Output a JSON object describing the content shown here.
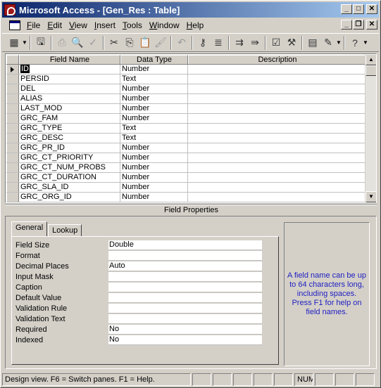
{
  "window": {
    "title": "Microsoft Access - [Gen_Res : Table]",
    "minimize": "_",
    "maximize": "□",
    "close": "✕"
  },
  "menu": {
    "items": [
      "File",
      "Edit",
      "View",
      "Insert",
      "Tools",
      "Window",
      "Help"
    ],
    "doc_min": "_",
    "doc_restore": "❐",
    "doc_close": "✕"
  },
  "toolbar": {
    "icons": [
      "view-icon",
      "save-icon",
      "print-icon",
      "print-preview-icon",
      "spelling-icon",
      "cut-icon",
      "copy-icon",
      "paste-icon",
      "format-painter-icon",
      "undo-icon",
      "primary-key-icon",
      "indexes-icon",
      "insert-rows-icon",
      "delete-rows-icon",
      "properties-icon",
      "build-icon",
      "database-window-icon",
      "new-object-icon",
      "help-icon"
    ]
  },
  "grid": {
    "headers": {
      "field_name": "Field Name",
      "data_type": "Data Type",
      "description": "Description"
    },
    "rows": [
      {
        "name": "ID",
        "type": "Number",
        "desc": ""
      },
      {
        "name": "PERSID",
        "type": "Text",
        "desc": ""
      },
      {
        "name": "DEL",
        "type": "Number",
        "desc": ""
      },
      {
        "name": "ALIAS",
        "type": "Number",
        "desc": ""
      },
      {
        "name": "LAST_MOD",
        "type": "Number",
        "desc": ""
      },
      {
        "name": "GRC_FAM",
        "type": "Number",
        "desc": ""
      },
      {
        "name": "GRC_TYPE",
        "type": "Text",
        "desc": ""
      },
      {
        "name": "GRC_DESC",
        "type": "Text",
        "desc": ""
      },
      {
        "name": "GRC_PR_ID",
        "type": "Number",
        "desc": ""
      },
      {
        "name": "GRC_CT_PRIORITY",
        "type": "Number",
        "desc": ""
      },
      {
        "name": "GRC_CT_NUM_PROBS",
        "type": "Number",
        "desc": ""
      },
      {
        "name": "GRC_CT_DURATION",
        "type": "Number",
        "desc": ""
      },
      {
        "name": "GRC_SLA_ID",
        "type": "Number",
        "desc": ""
      },
      {
        "name": "GRC_ORG_ID",
        "type": "Number",
        "desc": ""
      }
    ]
  },
  "field_properties": {
    "title": "Field Properties",
    "tabs": [
      "General",
      "Lookup"
    ],
    "properties": [
      {
        "label": "Field Size",
        "value": "Double"
      },
      {
        "label": "Format",
        "value": ""
      },
      {
        "label": "Decimal Places",
        "value": "Auto"
      },
      {
        "label": "Input Mask",
        "value": ""
      },
      {
        "label": "Caption",
        "value": ""
      },
      {
        "label": "Default Value",
        "value": ""
      },
      {
        "label": "Validation Rule",
        "value": ""
      },
      {
        "label": "Validation Text",
        "value": ""
      },
      {
        "label": "Required",
        "value": "No"
      },
      {
        "label": "Indexed",
        "value": "No"
      }
    ],
    "help_text": "A field name can be up to 64 characters long, including spaces. Press F1 for help on field names."
  },
  "status": {
    "message": "Design view.  F6 = Switch panes.  F1 = Help.",
    "num": "NUM"
  }
}
